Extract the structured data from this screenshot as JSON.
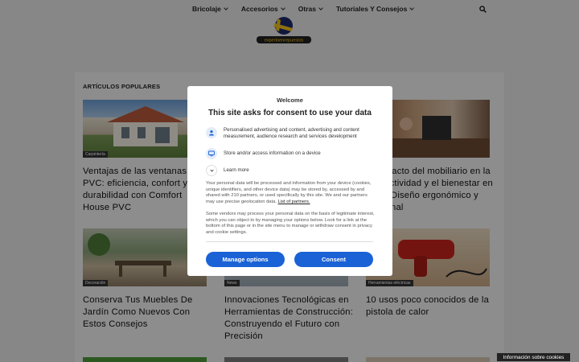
{
  "nav": {
    "items": [
      {
        "label": "Bricolaje"
      },
      {
        "label": "Accesorios"
      },
      {
        "label": "Otras"
      },
      {
        "label": "Tutoriales Y Consejos"
      }
    ]
  },
  "logo": {
    "text": "expertoenrepuestos"
  },
  "section": {
    "title": "ARTÍCULOS POPULARES"
  },
  "cards": [
    {
      "tag": "Carpintería",
      "title": "Ventajas de las ventanas de PVC: eficiencia, confort y durabilidad con Comfort House PVC"
    },
    {
      "tag": "",
      "title": "El impacto del mobiliario en la productividad y el bienestar en casa: Diseño ergonómico y funcional"
    },
    {
      "tag": "Decoración",
      "title": "Conserva Tus Muebles De Jardín Como Nuevos Con Estos Consejos"
    },
    {
      "tag": "News",
      "title": "Innovaciones Tecnológicas en Herramientas de Construcción: Construyendo el Futuro con Precisión"
    },
    {
      "tag": "Herramientas eléctricas",
      "title": "10 usos poco conocidos de la pistola de calor"
    }
  ],
  "consent": {
    "welcome": "Welcome",
    "title": "This site asks for consent to use your data",
    "purposes": [
      {
        "icon": "person-icon",
        "text": "Personalised advertising and content, advertising and content measurement, audience research and services development"
      },
      {
        "icon": "device-icon",
        "text": "Store and/or access information on a device"
      }
    ],
    "learn_more": "Learn more",
    "para1": "Your personal data will be processed and information from your device (cookies, unique identifiers, and other device data) may be stored by, accessed by and shared with 210 partners, or used specifically by this site. We and our partners may use precise geolocation data.",
    "partners_link": "List of partners.",
    "para2": "Some vendors may process your personal data on the basis of legitimate interest, which you can object to by managing your options below. Look for a link at the bottom of this page or in the site menu to manage or withdraw consent in privacy and cookie settings.",
    "manage_label": "Manage options",
    "consent_label": "Consent",
    "accent_color": "#1a62d6"
  },
  "cookie_info": {
    "label": "Información sobre cookies"
  }
}
